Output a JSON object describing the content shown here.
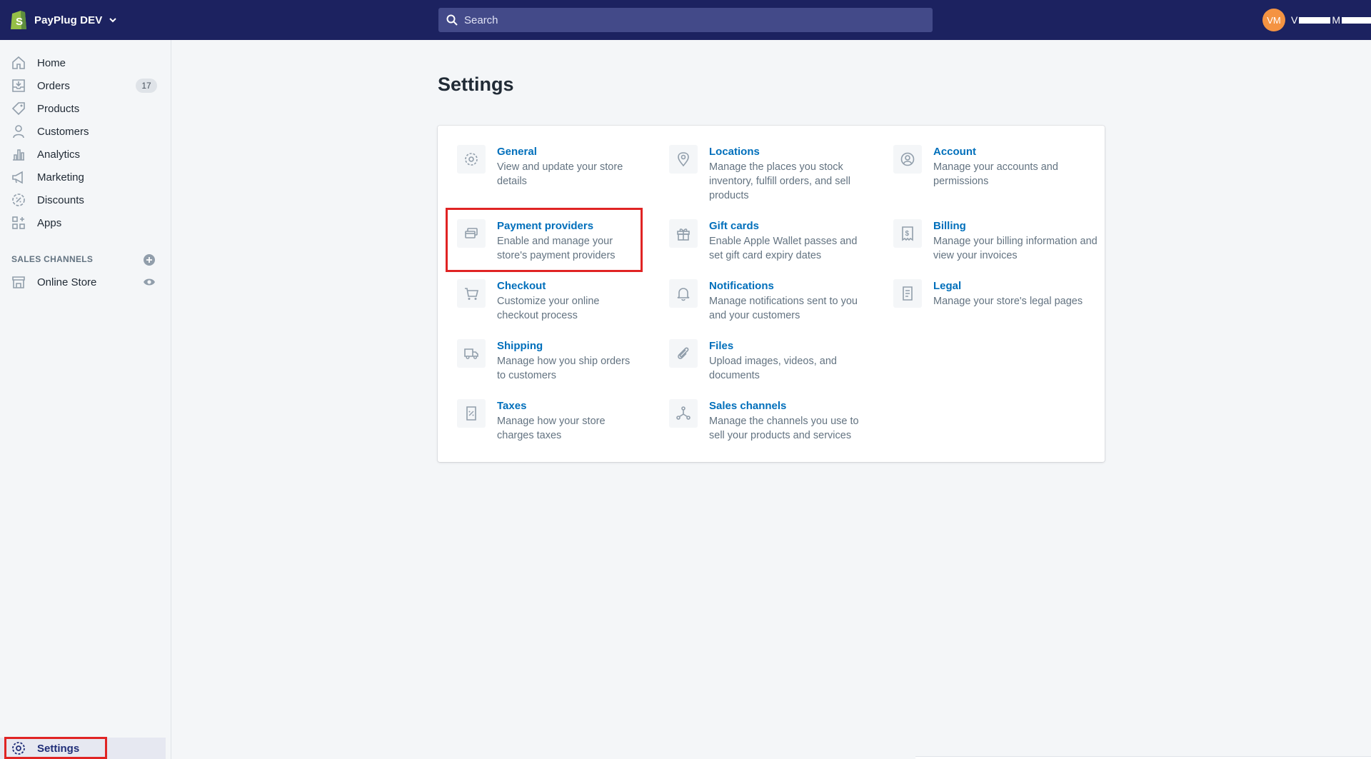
{
  "topbar": {
    "store_name": "PayPlug DEV",
    "search_placeholder": "Search",
    "avatar_initials": "VM",
    "user_name_prefix": "V",
    "user_name_middle": "M"
  },
  "sidebar": {
    "items": [
      {
        "label": "Home",
        "icon": "home-icon"
      },
      {
        "label": "Orders",
        "icon": "orders-icon",
        "badge": "17"
      },
      {
        "label": "Products",
        "icon": "tag-icon"
      },
      {
        "label": "Customers",
        "icon": "person-icon"
      },
      {
        "label": "Analytics",
        "icon": "bar-chart-icon"
      },
      {
        "label": "Marketing",
        "icon": "megaphone-icon"
      },
      {
        "label": "Discounts",
        "icon": "discount-icon"
      },
      {
        "label": "Apps",
        "icon": "apps-icon"
      }
    ],
    "sales_channels_heading": "SALES CHANNELS",
    "online_store_label": "Online Store",
    "settings_label": "Settings"
  },
  "main": {
    "title": "Settings",
    "settings": [
      {
        "title": "General",
        "desc": "View and update your store details",
        "icon": "gear-icon"
      },
      {
        "title": "Locations",
        "desc": "Manage the places you stock inventory, fulfill orders, and sell products",
        "icon": "location-pin-icon"
      },
      {
        "title": "Account",
        "desc": "Manage your accounts and permissions",
        "icon": "account-icon"
      },
      {
        "title": "Payment providers",
        "desc": "Enable and manage your store's payment providers",
        "icon": "payment-icon"
      },
      {
        "title": "Gift cards",
        "desc": "Enable Apple Wallet passes and set gift card expiry dates",
        "icon": "gift-icon"
      },
      {
        "title": "Billing",
        "desc": "Manage your billing information and view your invoices",
        "icon": "billing-icon"
      },
      {
        "title": "Checkout",
        "desc": "Customize your online checkout process",
        "icon": "cart-icon"
      },
      {
        "title": "Notifications",
        "desc": "Manage notifications sent to you and your customers",
        "icon": "bell-icon"
      },
      {
        "title": "Legal",
        "desc": "Manage your store's legal pages",
        "icon": "legal-icon"
      },
      {
        "title": "Shipping",
        "desc": "Manage how you ship orders to customers",
        "icon": "truck-icon"
      },
      {
        "title": "Files",
        "desc": "Upload images, videos, and documents",
        "icon": "paperclip-icon"
      },
      {
        "title": "Taxes",
        "desc": "Manage how your store charges taxes",
        "icon": "tax-receipt-icon"
      },
      {
        "title": "Sales channels",
        "desc": "Manage the channels you use to sell your products and services",
        "icon": "channels-icon"
      }
    ]
  },
  "colors": {
    "topbar": "#1c2260",
    "link": "#006fbb",
    "highlight": "#e02424",
    "avatar": "#f49342"
  }
}
